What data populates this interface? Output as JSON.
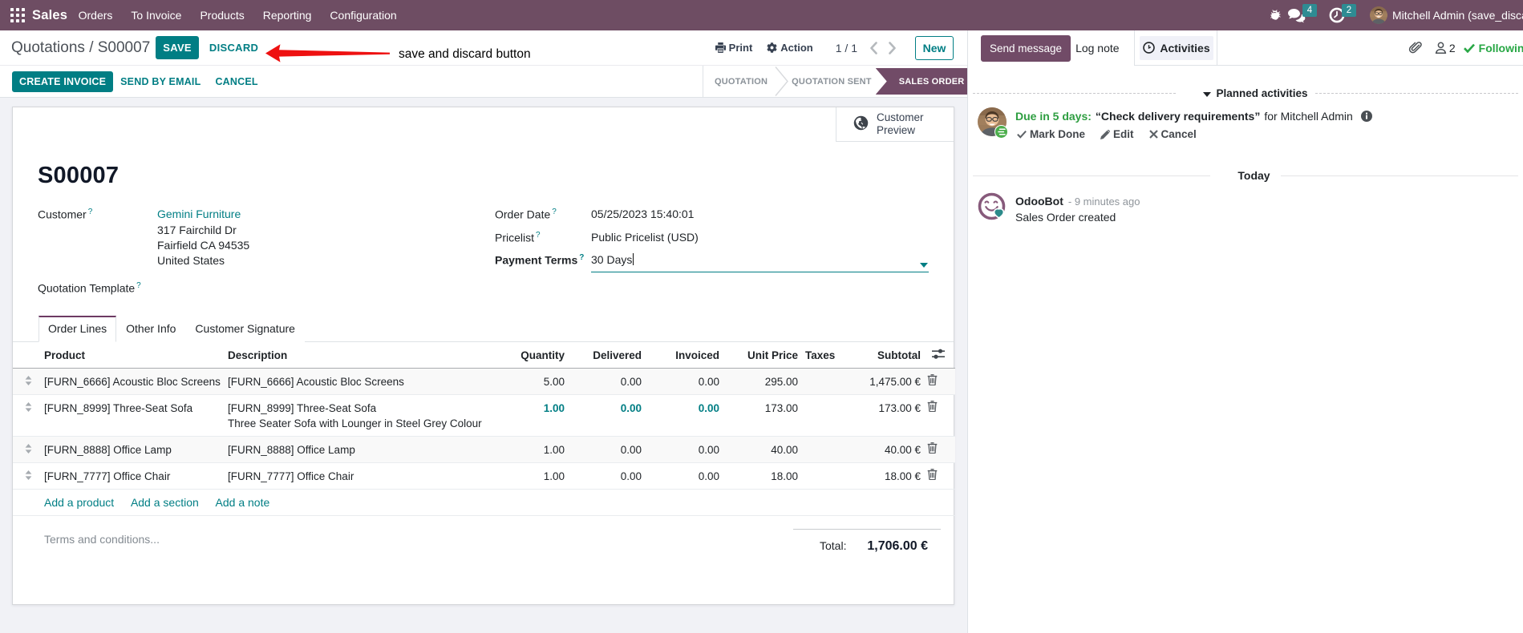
{
  "topbar": {
    "brand": "Sales",
    "menus": [
      "Orders",
      "To Invoice",
      "Products",
      "Reporting",
      "Configuration"
    ],
    "message_count": "4",
    "activity_count": "2",
    "user_name": "Mitchell Admin (save_discard",
    "icons": [
      "apps-grid-icon",
      "bug-icon",
      "messages-icon",
      "activity-clock-icon",
      "user-avatar"
    ]
  },
  "control_panel": {
    "breadcrumb_parent": "Quotations",
    "breadcrumb_separator": "/",
    "breadcrumb_current": "S00007",
    "save_label": "SAVE",
    "discard_label": "DISCARD",
    "annotation_text": "save and discard button",
    "annotation_color": "#ee1111",
    "print_label": "Print",
    "action_label": "Action",
    "pager": "1 / 1",
    "new_label": "New"
  },
  "action_buttons": {
    "create_invoice": "CREATE INVOICE",
    "send_by_email": "SEND BY EMAIL",
    "cancel": "CANCEL"
  },
  "statusbar": {
    "steps": [
      "QUOTATION",
      "QUOTATION SENT",
      "SALES ORDER"
    ],
    "active_step": "SALES ORDER"
  },
  "form": {
    "smart_button": {
      "line1": "Customer",
      "line2": "Preview",
      "icon": "globe-icon"
    },
    "title": "S00007",
    "customer": {
      "label": "Customer",
      "help": "?",
      "name": "Gemini Furniture",
      "address_lines": [
        "317 Fairchild Dr",
        "Fairfield CA 94535",
        "United States"
      ]
    },
    "quotation_template": {
      "label": "Quotation Template",
      "help": "?",
      "value": ""
    },
    "order_date": {
      "label": "Order Date",
      "help": "?",
      "value": "05/25/2023 15:40:01"
    },
    "pricelist": {
      "label": "Pricelist",
      "help": "?",
      "value": "Public Pricelist (USD)"
    },
    "payment_terms": {
      "label": "Payment Terms",
      "help": "?",
      "value": "30 Days"
    },
    "tabs": [
      {
        "label": "Order Lines",
        "active": true
      },
      {
        "label": "Other Info",
        "active": false
      },
      {
        "label": "Customer Signature",
        "active": false
      }
    ],
    "order_lines": {
      "columns": {
        "product": "Product",
        "description": "Description",
        "quantity": "Quantity",
        "delivered": "Delivered",
        "invoiced": "Invoiced",
        "unit_price": "Unit Price",
        "taxes": "Taxes",
        "subtotal": "Subtotal"
      },
      "rows": [
        {
          "product": "[FURN_6666] Acoustic Bloc Screens",
          "description": "[FURN_6666] Acoustic Bloc Screens",
          "description2": "",
          "quantity": "5.00",
          "delivered": "0.00",
          "invoiced": "0.00",
          "unit_price": "295.00",
          "taxes": "",
          "subtotal": "1,475.00 €"
        },
        {
          "product": "[FURN_8999] Three-Seat Sofa",
          "description": "[FURN_8999] Three-Seat Sofa",
          "description2": "Three Seater Sofa with Lounger in Steel Grey Colour",
          "quantity": "1.00",
          "delivered": "0.00",
          "invoiced": "0.00",
          "unit_price": "173.00",
          "taxes": "",
          "subtotal": "173.00 €"
        },
        {
          "product": "[FURN_8888] Office Lamp",
          "description": "[FURN_8888] Office Lamp",
          "description2": "",
          "quantity": "1.00",
          "delivered": "0.00",
          "invoiced": "0.00",
          "unit_price": "40.00",
          "taxes": "",
          "subtotal": "40.00 €"
        },
        {
          "product": "[FURN_7777] Office Chair",
          "description": "[FURN_7777] Office Chair",
          "description2": "",
          "quantity": "1.00",
          "delivered": "0.00",
          "invoiced": "0.00",
          "unit_price": "18.00",
          "taxes": "",
          "subtotal": "18.00 €"
        }
      ],
      "add_links": {
        "product": "Add a product",
        "section": "Add a section",
        "note": "Add a note"
      }
    },
    "terms_placeholder": "Terms and conditions...",
    "total": {
      "label": "Total:",
      "value": "1,706.00 €"
    }
  },
  "chatter": {
    "send_message": "Send message",
    "log_note": "Log note",
    "activities": "Activities",
    "follower_count": "2",
    "following_label": "Following",
    "planned_activities": {
      "header": "Planned activities",
      "due": "Due in 5 days:",
      "activity_title": "“Check delivery requirements”",
      "assignee": "for Mitchell Admin",
      "mark_done": "Mark Done",
      "edit": "Edit",
      "cancel": "Cancel"
    },
    "today_divider": "Today",
    "message": {
      "author": "OdooBot",
      "time": "- 9 minutes ago",
      "body": "Sales Order created"
    }
  },
  "colors": {
    "brand_purple": "#714B67",
    "accent_teal": "#017e84",
    "badge_teal": "#2e8c93",
    "success_green": "#2e9e41",
    "page_background": "#f1f2f6"
  }
}
